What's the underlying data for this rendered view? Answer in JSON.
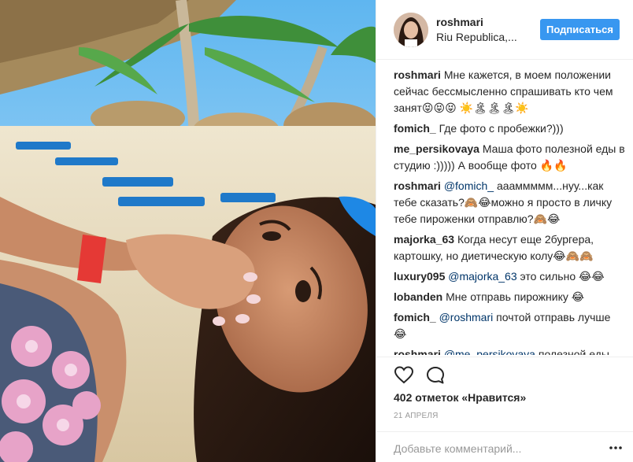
{
  "header": {
    "username": "roshmari",
    "location": "Riu Republica,...",
    "follow_label": "Подписаться"
  },
  "comments": [
    {
      "user": "roshmari",
      "mention": "",
      "text": "Мне кажется, в моем положении сейчас бессмысленно спрашивать кто чем занят😝😝😝 ☀️🏝🏝🏝☀️"
    },
    {
      "user": "fomich_",
      "mention": "",
      "text": "Где фото с пробежки?)))"
    },
    {
      "user": "me_persikovaya",
      "mention": "",
      "text": "Маша фото полезной еды в студию :))))) А вообще фото 🔥🔥"
    },
    {
      "user": "roshmari",
      "mention": "@fomich_",
      "text": "аааммммм...нуу...как тебе сказать?🙈😂можно я просто в личку тебе пироженки отправлю?🙈😂"
    },
    {
      "user": "majorka_63",
      "mention": "",
      "text": "Когда несут еще 2бургера, картошку, но диетическую колу😂🙈🙈"
    },
    {
      "user": "luxury095",
      "mention": "@majorka_63",
      "text": "это сильно 😂😂"
    },
    {
      "user": "lobanden",
      "mention": "",
      "text": "Мне отправь пирожнику 😂"
    },
    {
      "user": "fomich_",
      "mention": "@roshmari",
      "text": "почтой отправь лучше 😂"
    },
    {
      "user": "roshmari",
      "mention": "@me_persikovaya",
      "text": "полезной еды нет🙈сорян😂😂😂"
    }
  ],
  "actions": {
    "like_icon": "heart-icon",
    "comment_icon": "comment-bubble-icon"
  },
  "likes_text": "402 отметок «Нравится»",
  "date_text": "21 АПРЕЛЯ",
  "add_comment": {
    "placeholder": "Добавьте комментарий...",
    "more_icon": "more-dots-icon"
  },
  "colors": {
    "follow_button": "#3897f0",
    "mention": "#003569",
    "muted": "#999999",
    "divider": "#efefef"
  }
}
